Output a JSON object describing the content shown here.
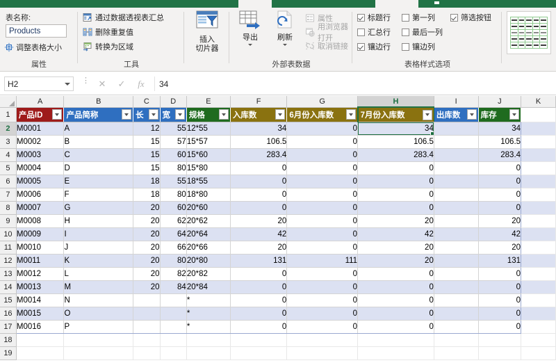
{
  "ribbon": {
    "groups": {
      "properties": {
        "label": "属性",
        "table_name_label": "表名称:",
        "table_name_value": "Products",
        "resize_label": "调整表格大小",
        "resize_icon": "resize-table-icon"
      },
      "tools": {
        "label": "工具",
        "items": [
          {
            "label": "通过数据透视表汇总",
            "icon": "pivot-table-icon"
          },
          {
            "label": "删除重复值",
            "icon": "remove-duplicates-icon"
          },
          {
            "label": "转换为区域",
            "icon": "convert-to-range-icon"
          }
        ]
      },
      "slicer": {
        "label": "",
        "button_line1": "插入",
        "button_line2": "切片器",
        "icon": "insert-slicer-icon"
      },
      "external": {
        "label": "外部表数据",
        "export_label": "导出",
        "export_icon": "export-icon",
        "refresh_label": "刷新",
        "refresh_icon": "refresh-icon",
        "small_items": [
          {
            "label": "属性",
            "icon": "properties-icon"
          },
          {
            "label": "用浏览器打开",
            "icon": "open-in-browser-icon"
          },
          {
            "label": "取消链接",
            "icon": "unlink-icon"
          }
        ]
      },
      "style_options": {
        "label": "表格样式选项",
        "checkboxes": [
          {
            "label": "标题行",
            "checked": true,
            "col": "a",
            "row": 1
          },
          {
            "label": "汇总行",
            "checked": false,
            "col": "a",
            "row": 2
          },
          {
            "label": "镶边行",
            "checked": true,
            "col": "a",
            "row": 3
          },
          {
            "label": "第一列",
            "checked": false,
            "col": "b",
            "row": 1
          },
          {
            "label": "最后一列",
            "checked": false,
            "col": "b",
            "row": 2
          },
          {
            "label": "镶边列",
            "checked": false,
            "col": "b",
            "row": 3
          },
          {
            "label": "筛选按钮",
            "checked": true,
            "col": "c",
            "row": 1
          }
        ]
      },
      "gallery": {
        "label": "",
        "icon": "table-style-swatch"
      }
    }
  },
  "formula_bar": {
    "name_box": "H2",
    "cancel_icon": "cancel-icon",
    "enter_icon": "confirm-icon",
    "function_icon": "fx-icon",
    "formula_value": "34"
  },
  "sheet": {
    "column_letters": [
      "A",
      "B",
      "C",
      "D",
      "E",
      "F",
      "G",
      "H",
      "I",
      "J",
      "K"
    ],
    "selected_column": "H",
    "selected_row": 2,
    "selected_cell": "H2",
    "row_numbers": [
      1,
      2,
      3,
      4,
      5,
      6,
      7,
      8,
      9,
      10,
      11,
      12,
      13,
      14,
      15,
      16,
      17,
      18,
      19
    ],
    "header_colors": {
      "产品ID": "#9e1b1b",
      "产品简称": "#2f6fc0",
      "长": "#2f6fc0",
      "宽": "#2f6fc0",
      "规格": "#1f6b1f",
      "入库数": "#8a7210",
      "6月份入库数": "#8a7210",
      "7月份入库数": "#8a7210",
      "出库数": "#2f6fc0",
      "库存": "#1f6b1f"
    },
    "table_headers": [
      "产品ID",
      "产品简称",
      "长",
      "宽",
      "规格",
      "入库数",
      "6月份入库数",
      "7月份入库数",
      "出库数",
      "库存"
    ],
    "rows": [
      {
        "id": "M0001",
        "name": "A",
        "len": "12",
        "wid": "55",
        "spec": "12*55",
        "in": "34",
        "jun": "0",
        "jul": "34",
        "out": "",
        "stock": "34"
      },
      {
        "id": "M0002",
        "name": "B",
        "len": "15",
        "wid": "57",
        "spec": "15*57",
        "in": "106.5",
        "jun": "0",
        "jul": "106.5",
        "out": "",
        "stock": "106.5"
      },
      {
        "id": "M0003",
        "name": "C",
        "len": "15",
        "wid": "60",
        "spec": "15*60",
        "in": "283.4",
        "jun": "0",
        "jul": "283.4",
        "out": "",
        "stock": "283.4"
      },
      {
        "id": "M0004",
        "name": "D",
        "len": "15",
        "wid": "80",
        "spec": "15*80",
        "in": "0",
        "jun": "0",
        "jul": "0",
        "out": "",
        "stock": "0"
      },
      {
        "id": "M0005",
        "name": "E",
        "len": "18",
        "wid": "55",
        "spec": "18*55",
        "in": "0",
        "jun": "0",
        "jul": "0",
        "out": "",
        "stock": "0"
      },
      {
        "id": "M0006",
        "name": "F",
        "len": "18",
        "wid": "80",
        "spec": "18*80",
        "in": "0",
        "jun": "0",
        "jul": "0",
        "out": "",
        "stock": "0"
      },
      {
        "id": "M0007",
        "name": "G",
        "len": "20",
        "wid": "60",
        "spec": "20*60",
        "in": "0",
        "jun": "0",
        "jul": "0",
        "out": "",
        "stock": "0"
      },
      {
        "id": "M0008",
        "name": "H",
        "len": "20",
        "wid": "62",
        "spec": "20*62",
        "in": "20",
        "jun": "0",
        "jul": "20",
        "out": "",
        "stock": "20"
      },
      {
        "id": "M0009",
        "name": "I",
        "len": "20",
        "wid": "64",
        "spec": "20*64",
        "in": "42",
        "jun": "0",
        "jul": "42",
        "out": "",
        "stock": "42"
      },
      {
        "id": "M0010",
        "name": "J",
        "len": "20",
        "wid": "66",
        "spec": "20*66",
        "in": "20",
        "jun": "0",
        "jul": "20",
        "out": "",
        "stock": "20"
      },
      {
        "id": "M0011",
        "name": "K",
        "len": "20",
        "wid": "80",
        "spec": "20*80",
        "in": "131",
        "jun": "111",
        "jul": "20",
        "out": "",
        "stock": "131"
      },
      {
        "id": "M0012",
        "name": "L",
        "len": "20",
        "wid": "82",
        "spec": "20*82",
        "in": "0",
        "jun": "0",
        "jul": "0",
        "out": "",
        "stock": "0"
      },
      {
        "id": "M0013",
        "name": "M",
        "len": "20",
        "wid": "84",
        "spec": "20*84",
        "in": "0",
        "jun": "0",
        "jul": "0",
        "out": "",
        "stock": "0"
      },
      {
        "id": "M0014",
        "name": "N",
        "len": "",
        "wid": "",
        "spec": "*",
        "in": "0",
        "jun": "0",
        "jul": "0",
        "out": "",
        "stock": "0"
      },
      {
        "id": "M0015",
        "name": "O",
        "len": "",
        "wid": "",
        "spec": "*",
        "in": "0",
        "jun": "0",
        "jul": "0",
        "out": "",
        "stock": "0"
      },
      {
        "id": "M0016",
        "name": "P",
        "len": "",
        "wid": "",
        "spec": "*",
        "in": "0",
        "jun": "0",
        "jul": "0",
        "out": "",
        "stock": "0"
      }
    ]
  }
}
